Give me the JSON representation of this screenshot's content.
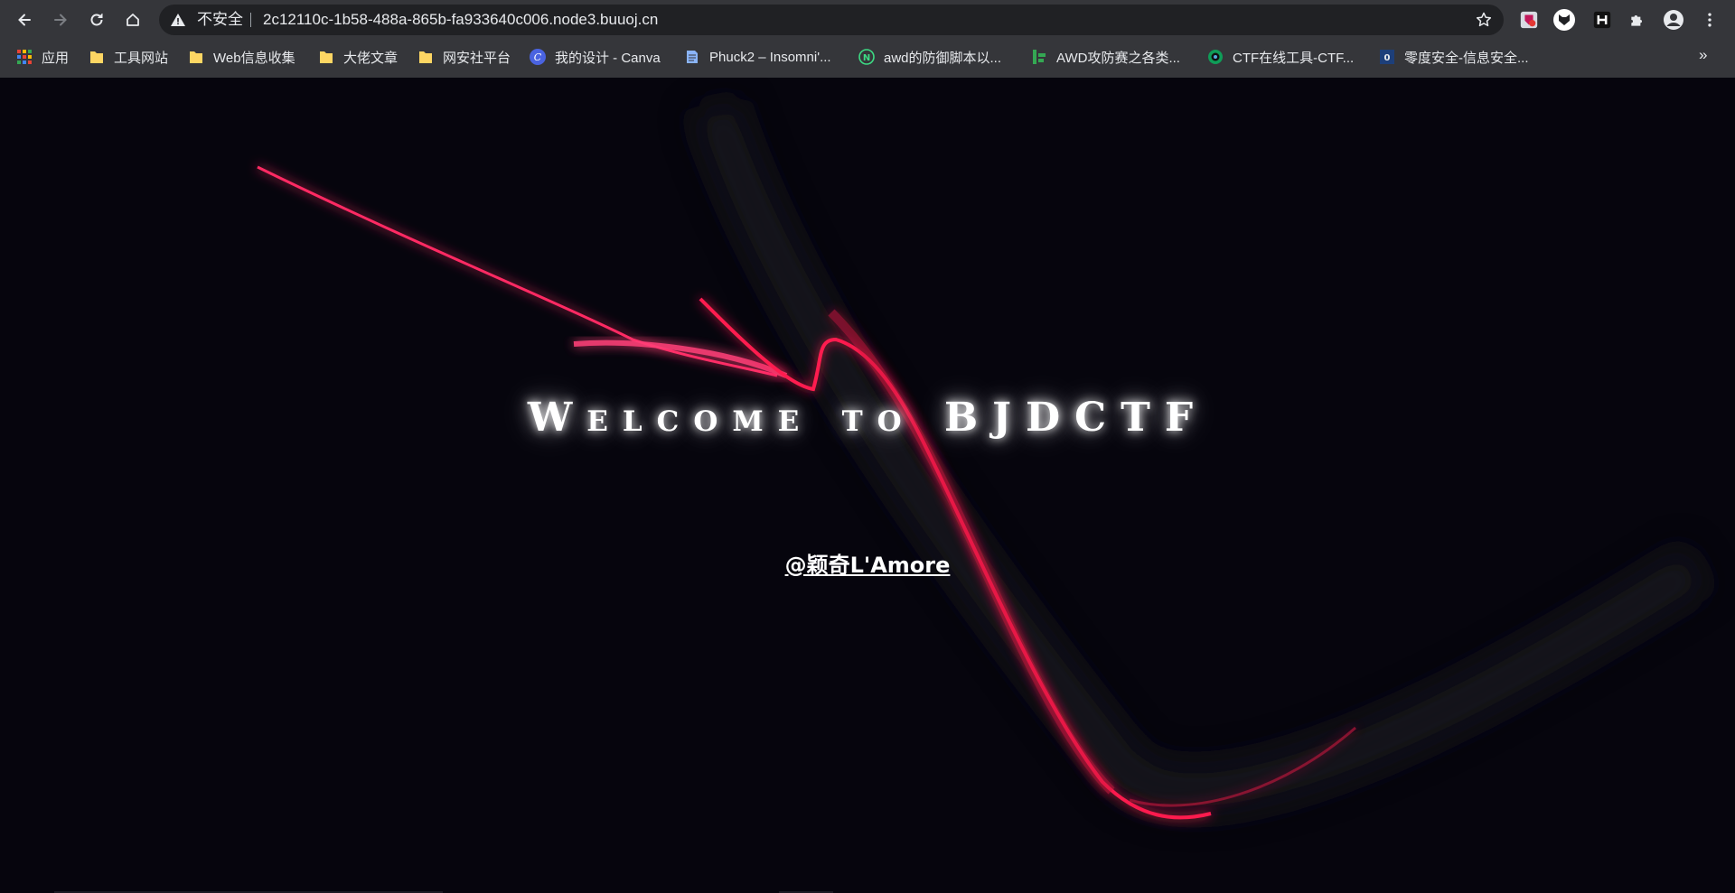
{
  "browser": {
    "security_label": "不安全",
    "url": "2c12110c-1b58-488a-865b-fa933640c006.node3.buuoj.cn"
  },
  "bookmarks": [
    {
      "label": "应用",
      "icon": "apps-grid-icon"
    },
    {
      "label": "工具网站",
      "icon": "folder-icon"
    },
    {
      "label": "Web信息收集",
      "icon": "folder-icon"
    },
    {
      "label": "大佬文章",
      "icon": "folder-icon"
    },
    {
      "label": "网安社平台",
      "icon": "folder-icon"
    },
    {
      "label": "我的设计 - Canva",
      "icon": "canva-icon"
    },
    {
      "label": "Phuck2 – Insomni'...",
      "icon": "page-icon"
    },
    {
      "label": "awd的防御脚本以...",
      "icon": "n-circle-icon"
    },
    {
      "label": "AWD攻防赛之各类...",
      "icon": "green-bars-icon"
    },
    {
      "label": "CTF在线工具-CTF...",
      "icon": "camera-icon"
    },
    {
      "label": "零度安全-信息安全...",
      "icon": "zero-logo-icon"
    }
  ],
  "bookmarks_overflow": "»",
  "page": {
    "title": "Welcome to BJDCTF",
    "author": "@颖奇L'Amore"
  },
  "colors": {
    "background": "#06050d",
    "ribbon": "#ff1e4f",
    "chrome": "#35363a",
    "omnibox": "#202124"
  }
}
